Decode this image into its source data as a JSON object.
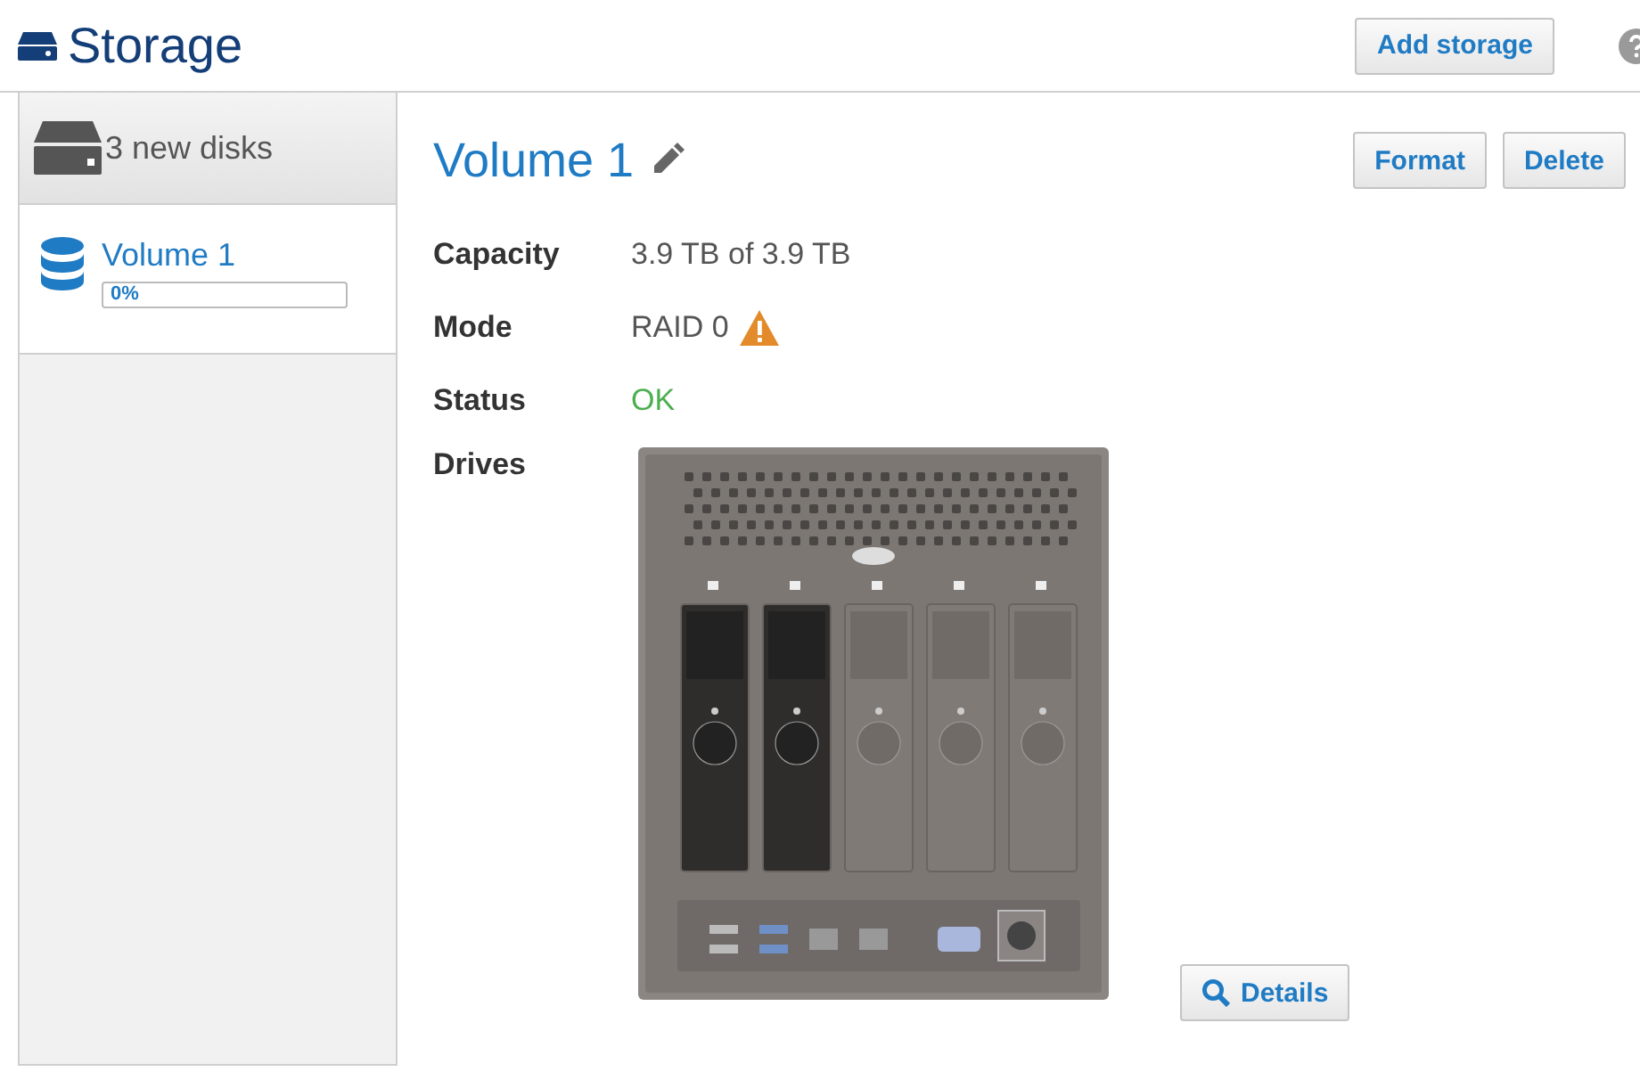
{
  "header": {
    "title": "Storage",
    "add_button": "Add storage"
  },
  "sidebar": {
    "new_disks": "3 new disks",
    "volumes": [
      {
        "name": "Volume 1",
        "progress_text": "0%",
        "level": 0,
        "selected": true
      }
    ]
  },
  "volume": {
    "title": "Volume 1",
    "buttons": [
      "Format",
      "Delete"
    ],
    "properties": [
      {
        "label": "Capacity",
        "value": "3.9 TB of 3.9 TB",
        "kind": "plain"
      },
      {
        "label": "Mode",
        "value": "RAID 0",
        "kind": "warning"
      },
      {
        "label": "Status",
        "value": "OK",
        "kind": "ok"
      }
    ],
    "drives_label": "Drives",
    "drives": [
      {
        "in_volume": true
      },
      {
        "in_volume": true
      },
      {
        "in_volume": false
      },
      {
        "in_volume": false
      },
      {
        "in_volume": false
      }
    ],
    "details_button": "Details"
  }
}
